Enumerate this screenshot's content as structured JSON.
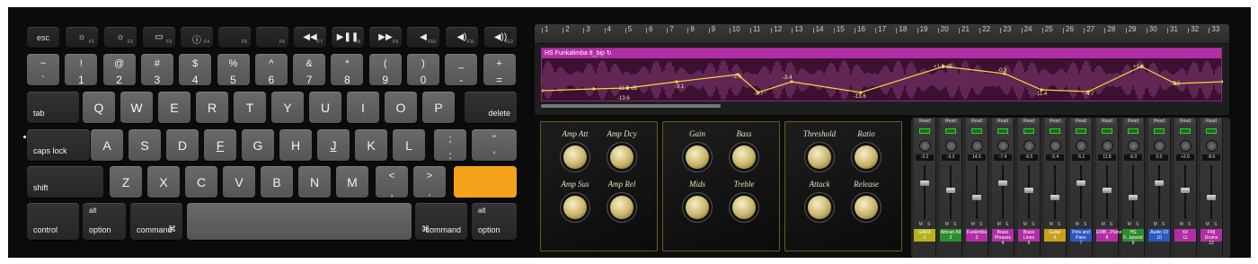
{
  "keyboard": {
    "fn_row": [
      {
        "label": "esc",
        "fkey": ""
      },
      {
        "label": "☼",
        "fkey": "F1"
      },
      {
        "label": "☼",
        "fkey": "F2"
      },
      {
        "label": "▭",
        "fkey": "F3"
      },
      {
        "label": "ⓘ",
        "fkey": "F4"
      },
      {
        "label": "",
        "fkey": "F5"
      },
      {
        "label": "",
        "fkey": "F6"
      },
      {
        "label": "◀◀",
        "fkey": "F7"
      },
      {
        "label": "▶❚❚",
        "fkey": "F8"
      },
      {
        "label": "▶▶",
        "fkey": "F9"
      },
      {
        "label": "◀",
        "fkey": "F10"
      },
      {
        "label": "◀)",
        "fkey": "F11"
      },
      {
        "label": "◀))",
        "fkey": "F12"
      }
    ],
    "number_row": [
      {
        "top": "~",
        "bot": "`"
      },
      {
        "top": "!",
        "bot": "1"
      },
      {
        "top": "@",
        "bot": "2"
      },
      {
        "top": "#",
        "bot": "3"
      },
      {
        "top": "$",
        "bot": "4"
      },
      {
        "top": "%",
        "bot": "5"
      },
      {
        "top": "^",
        "bot": "6"
      },
      {
        "top": "&",
        "bot": "7"
      },
      {
        "top": "*",
        "bot": "8"
      },
      {
        "top": "(",
        "bot": "9"
      },
      {
        "top": ")",
        "bot": "0"
      },
      {
        "top": "_",
        "bot": "-"
      },
      {
        "top": "+",
        "bot": "="
      }
    ],
    "delete_label": "delete",
    "tab_label": "tab",
    "q_row": [
      "Q",
      "W",
      "E",
      "R",
      "T",
      "Y",
      "U",
      "I",
      "O",
      "P"
    ],
    "caps_label": "caps lock",
    "a_row": [
      "A",
      "S",
      "D",
      "F",
      "G",
      "H",
      "J",
      "K",
      "L"
    ],
    "a_row_underscored": [
      "F",
      "J"
    ],
    "semicolon": {
      "top": ";",
      "bot": ":"
    },
    "quote": {
      "top": "\"",
      "bot": "'"
    },
    "shift_label": "shift",
    "z_row": [
      "Z",
      "X",
      "C",
      "V",
      "B",
      "N",
      "M"
    ],
    "lt": {
      "top": "<",
      "bot": ","
    },
    "gt": {
      "top": ">",
      "bot": "."
    },
    "control_label": "control",
    "alt_label": "alt",
    "option_label": "option",
    "command_label": "command",
    "command_symbol": "⌘",
    "accent_color": "#f4a21c"
  },
  "arrange": {
    "ruler": [
      "1",
      "2",
      "3",
      "4",
      "5",
      "6",
      "7",
      "8",
      "9",
      "10",
      "11",
      "12",
      "13",
      "14",
      "15",
      "16",
      "17",
      "18",
      "19",
      "20",
      "21",
      "22",
      "23",
      "24",
      "25",
      "26",
      "27",
      "28",
      "29",
      "30",
      "31",
      "32",
      "33"
    ],
    "region_name": "HS Funkalimba 8_bip",
    "region_color": "#b22ea6",
    "automation_labels": [
      "-11.6 dB",
      "-13.6",
      "-3.1",
      "-1.6",
      "-9.7",
      "-3.4",
      "-13.6",
      "+1.5 dB",
      "-0.3",
      "-11.4",
      "-4.7",
      "+1.9",
      "-7.5"
    ]
  },
  "plugin": {
    "panels": [
      {
        "knobs": [
          "Amp Att",
          "Amp Dcy",
          "Amp Sus",
          "Amp Rel"
        ]
      },
      {
        "knobs": [
          "Gain",
          "Bass",
          "Mids",
          "Treble"
        ]
      },
      {
        "knobs": [
          "Threshold",
          "Ratio",
          "Attack",
          "Release"
        ]
      }
    ]
  },
  "mixer": {
    "read_label": "Read",
    "mute_label": "M",
    "solo_label": "S",
    "channels": [
      {
        "name": "GAD3",
        "num": "1",
        "vol": "-3.2",
        "color": "#b7b21c"
      },
      {
        "name": "African Kit",
        "num": "2",
        "vol": "-3.3",
        "color": "#2e8c2e"
      },
      {
        "name": "Funkimba",
        "num": "3",
        "vol": "14.5",
        "color": "#b22ea6"
      },
      {
        "name": "Brass Phrases",
        "num": "4",
        "vol": "-7.4",
        "color": "#b22ea6"
      },
      {
        "name": "Brass Lines",
        "num": "5",
        "vol": "-6.5",
        "color": "#b22ea6"
      },
      {
        "name": "Guitar",
        "num": "6",
        "vol": "-5.4",
        "color": "#c9a019"
      },
      {
        "name": "Pots and Pans",
        "num": "7",
        "vol": "-5.1",
        "color": "#2c57c2"
      },
      {
        "name": "EWB...Piano",
        "num": "8",
        "vol": "11.8",
        "color": "#b22ea6"
      },
      {
        "name": "HS F...lanced",
        "num": "9",
        "vol": "-6.0",
        "color": "#2e8c2e"
      },
      {
        "name": "Audio 10",
        "num": "10",
        "vol": "0.0",
        "color": "#2c57c2"
      },
      {
        "name": "Kit",
        "num": "11",
        "vol": "+2.6",
        "color": "#b22ea6"
      },
      {
        "name": "Ffdj Drums",
        "num": "12",
        "vol": "-8.6",
        "color": "#b22ea6"
      }
    ]
  }
}
